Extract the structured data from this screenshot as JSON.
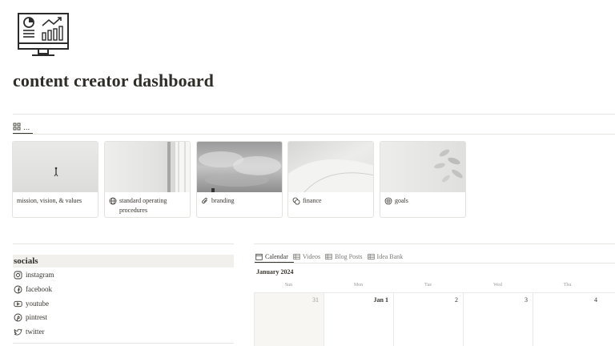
{
  "page": {
    "title": "content creator dashboard",
    "icon": "dashboard-monitor-icon"
  },
  "gallery": {
    "view_label": "...",
    "view_icon": "gallery-grid-icon",
    "cards": [
      {
        "label": "mission, vision, & values",
        "icon": ""
      },
      {
        "label": "standard operating procedures",
        "icon": "globe-icon"
      },
      {
        "label": "branding",
        "icon": "paperclip-icon"
      },
      {
        "label": "finance",
        "icon": "coins-icon"
      },
      {
        "label": "goals",
        "icon": "target-icon"
      }
    ]
  },
  "socials": {
    "heading": "socials",
    "items": [
      {
        "label": "instagram",
        "icon": "instagram-icon"
      },
      {
        "label": "facebook",
        "icon": "facebook-icon"
      },
      {
        "label": "youtube",
        "icon": "youtube-icon"
      },
      {
        "label": "pintrest",
        "icon": "pinterest-icon"
      },
      {
        "label": "twitter",
        "icon": "twitter-icon"
      }
    ]
  },
  "calendar": {
    "tabs": [
      {
        "label": "Calendar",
        "icon": "calendar-icon",
        "active": true
      },
      {
        "label": "Videos",
        "icon": "table-icon",
        "active": false
      },
      {
        "label": "Blog Posts",
        "icon": "table-icon",
        "active": false
      },
      {
        "label": "Idea Bank",
        "icon": "table-icon",
        "active": false
      }
    ],
    "month": "January 2024",
    "weekdays": [
      "Sun",
      "Mon",
      "Tue",
      "Wed",
      "Thu"
    ],
    "days": [
      "31",
      "Jan 1",
      "2",
      "3",
      "4"
    ]
  },
  "colors": {
    "text": "#37352f",
    "muted_text": "#9b9a97",
    "divider": "#e6e5e2",
    "socials_heading_bg": "#f1f0ec",
    "muted_cell_bg": "#f7f6f3"
  }
}
